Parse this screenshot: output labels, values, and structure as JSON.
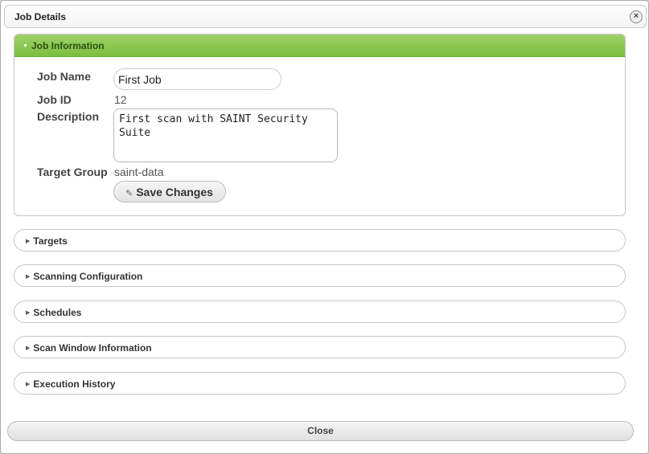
{
  "dialog": {
    "title": "Job Details",
    "close_icon": "×"
  },
  "job_info": {
    "header": "Job Information",
    "name_label": "Job Name",
    "name_value": "First Job",
    "id_label": "Job ID",
    "id_value": "12",
    "description_label": "Description",
    "description_value": "First scan with SAINT Security Suite",
    "target_group_label": "Target Group",
    "target_group_value": "saint-data",
    "save_label": "Save Changes",
    "save_icon": "✎",
    "accent_color": "#7bbf3f"
  },
  "sections": [
    {
      "label": "Targets"
    },
    {
      "label": "Scanning Configuration"
    },
    {
      "label": "Schedules"
    },
    {
      "label": "Scan Window Information"
    },
    {
      "label": "Execution History"
    }
  ],
  "footer": {
    "close_label": "Close"
  }
}
